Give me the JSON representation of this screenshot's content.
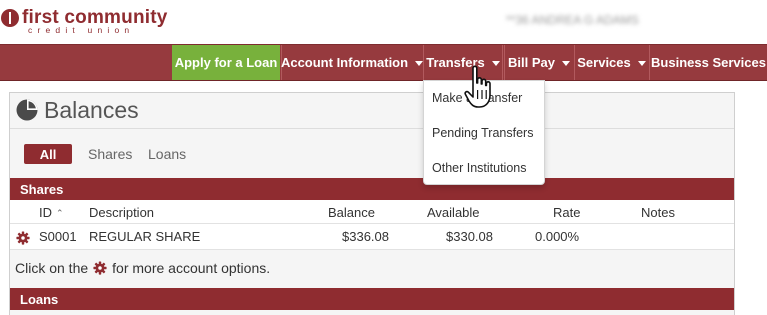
{
  "brand": {
    "name_line1": "first community",
    "name_line2": "credit union",
    "color": "#8f2c30"
  },
  "header": {
    "user_name": "**36 ANDREA G ADAMS"
  },
  "nav": {
    "apply": "Apply for a Loan",
    "account_information": "Account Information",
    "transfers": "Transfers",
    "bill_pay": "Bill Pay",
    "services": "Services",
    "business_services": "Business Services",
    "accent_color": "#78b13c",
    "bar_color": "#963a3e"
  },
  "transfers_menu": {
    "items": [
      "Make a Transfer",
      "Pending Transfers",
      "Other Institutions"
    ]
  },
  "balances": {
    "title": "Balances",
    "title_icon": "pie-chart-icon",
    "filters": {
      "all": "All",
      "shares": "Shares",
      "loans": "Loans"
    },
    "shares_section": {
      "label": "Shares",
      "columns": {
        "id": "ID",
        "description": "Description",
        "balance": "Balance",
        "available": "Available",
        "rate": "Rate",
        "notes": "Notes"
      },
      "rows": [
        {
          "id": "S0001",
          "description": "REGULAR SHARE",
          "balance": "$336.08",
          "available": "$330.08",
          "rate": "0.000%",
          "notes": ""
        }
      ]
    },
    "hint": {
      "before": "Click on the",
      "after": "for more account options.",
      "icon": "gear-icon"
    },
    "loans_section": {
      "label": "Loans"
    }
  }
}
